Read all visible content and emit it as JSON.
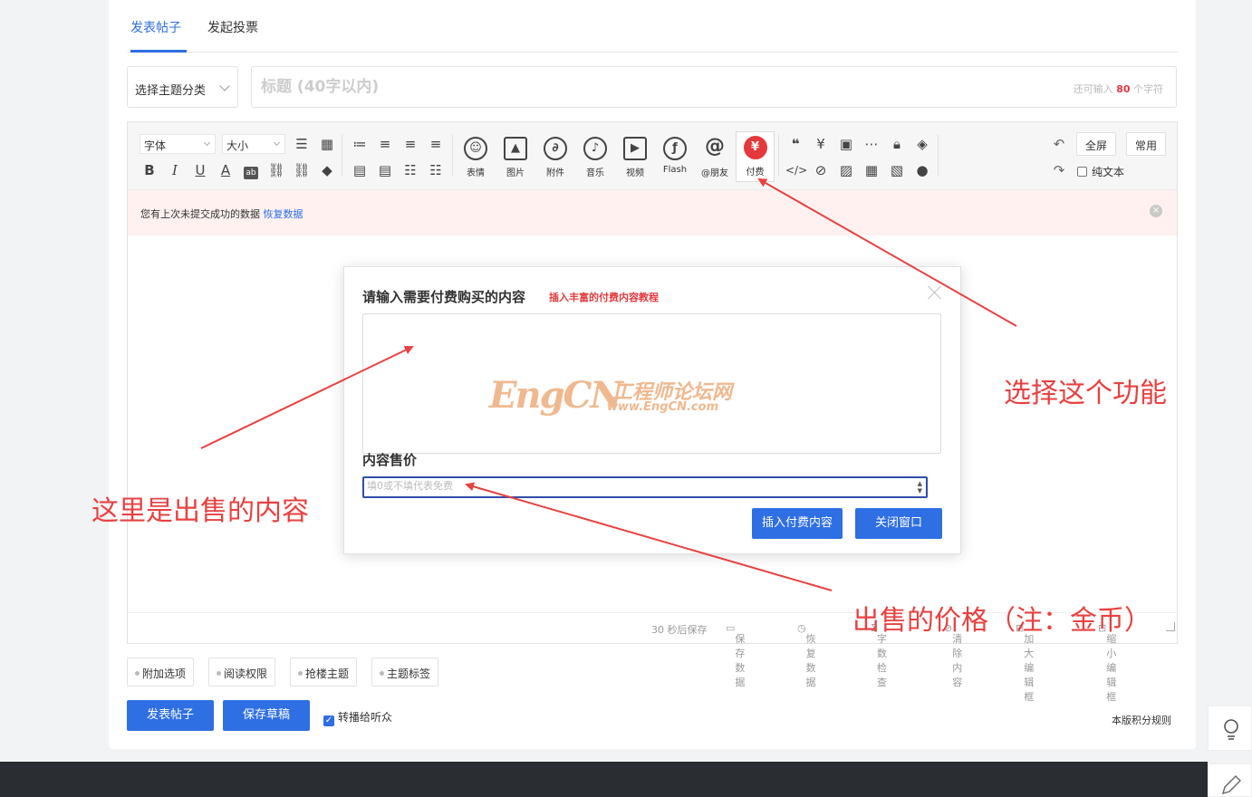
{
  "tabs": [
    {
      "label": "发表帖子",
      "active": true
    },
    {
      "label": "发起投票",
      "active": false
    }
  ],
  "category_select": {
    "label": "选择主题分类"
  },
  "title_input": {
    "placeholder": "标题 (40字以内)",
    "remain_prefix": "还可输入",
    "remain_count": "80",
    "remain_suffix": "个字符"
  },
  "toolbar": {
    "font_select": "字体",
    "size_select": "大小",
    "small_icons_row1": [
      "list-icon",
      "table-icon",
      "ordered-list-icon",
      "align-left-icon",
      "align-center-icon",
      "align-right-icon"
    ],
    "small_icons_row2": [
      "bold-icon",
      "italic-icon",
      "underline-icon",
      "font-color-icon",
      "background-color-icon",
      "link-icon",
      "unlink-icon",
      "eraser-icon",
      "float-left-icon",
      "float-right-icon",
      "list-icon",
      "bullet-list-icon"
    ],
    "big_buttons": [
      {
        "label": "表情",
        "icon": "smile-icon"
      },
      {
        "label": "图片",
        "icon": "image-icon"
      },
      {
        "label": "附件",
        "icon": "attachment-icon"
      },
      {
        "label": "音乐",
        "icon": "music-icon"
      },
      {
        "label": "视频",
        "icon": "video-icon"
      },
      {
        "label": "Flash",
        "icon": "flash-icon"
      },
      {
        "label": "@朋友",
        "icon": "at-icon"
      },
      {
        "label": "付费",
        "icon": "pay-icon"
      }
    ],
    "fullscreen": "全屏",
    "common": "常用",
    "plain_text": "纯文本"
  },
  "restore_bar": {
    "text": "您有上次未提交成功的数据",
    "link": "恢复数据"
  },
  "statusbar": {
    "autosave": "30 秒后保存",
    "items": [
      "保存数据",
      "恢复数据",
      "字数检查",
      "清除内容",
      "加大编辑框",
      "缩小编辑框"
    ]
  },
  "modal": {
    "title": "请输入需要付费购买的内容",
    "tutorial_link": "插入丰富的付费内容教程",
    "price_label": "内容售价",
    "price_placeholder": "填0或不填代表免费",
    "insert_button": "插入付费内容",
    "close_button": "关闭窗口",
    "watermark": {
      "logo": "EngCN",
      "cn": "工程师论坛网",
      "url": "www.EngCN.com"
    }
  },
  "options": [
    "附加选项",
    "阅读权限",
    "抢楼主题",
    "主题标签"
  ],
  "actions": {
    "publish": "发表帖子",
    "save_draft": "保存草稿",
    "forward": "转播给听众",
    "rules": "本版积分规则"
  },
  "annotations": {
    "select_feature": "选择这个功能",
    "content_for_sale": "这里是出售的内容",
    "sale_price": "出售的价格（注：金币）"
  },
  "colors": {
    "accent": "#2f6fe4",
    "annotation": "#e84141",
    "footer": "#2a2e33"
  }
}
